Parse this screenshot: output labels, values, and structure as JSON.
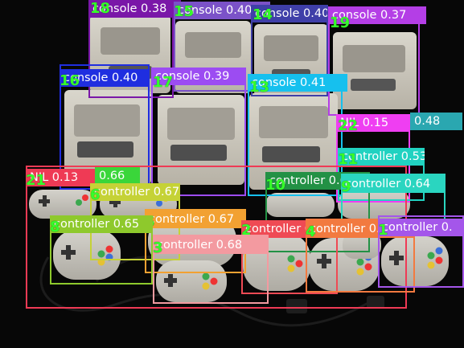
{
  "detections": [
    {
      "id": "18",
      "label": "console 0.38",
      "color": "#7a17a8"
    },
    {
      "id": "15",
      "label": "console 0.40",
      "color": "#7b52c8"
    },
    {
      "id": "14",
      "label": "console 0.40",
      "color": "#3f3fa8"
    },
    {
      "id": "19",
      "label": "console 0.37",
      "color": "#b43ee6"
    },
    {
      "id": "16",
      "label": "console 0.40",
      "color": "#1f2ee0"
    },
    {
      "id": "17",
      "label": "console 0.39",
      "color": "#9c4cf2"
    },
    {
      "id": "13",
      "label": "console 0.41",
      "color": "#16c0ee"
    },
    {
      "id": "22",
      "label": "NIL 0.15",
      "color": "#ef3ef2"
    },
    {
      "id": "20",
      "label": "0.48",
      "color": "#2aa7b0"
    },
    {
      "id": "11",
      "label": "controller 0.53",
      "color": "#21d2c1"
    },
    {
      "id": "21",
      "label": "NIL 0.13",
      "color": "#ef3a55"
    },
    {
      "id": "10",
      "label": "controller 0.62",
      "color": "#239145"
    },
    {
      "id": "9",
      "label": "controller 0.64",
      "color": "#2ad5c0"
    },
    {
      "id": "7",
      "label": "0.66",
      "color": "#3ad63a"
    },
    {
      "id": "6",
      "label": "controller 0.67",
      "color": "#c5d236"
    },
    {
      "id": "5",
      "label": "controller 0.67",
      "color": "#f2a132"
    },
    {
      "id": "8",
      "label": "controller 0.65",
      "color": "#8ec92c"
    },
    {
      "id": "2",
      "label": "controller 0.68",
      "color": "#ef4a54"
    },
    {
      "id": "3",
      "label": "controller 0.68",
      "color": "#f39aa0"
    },
    {
      "id": "4",
      "label": "controller 0.67",
      "color": "#f27a40"
    },
    {
      "id": "1",
      "label": "controller 0.",
      "color": "#a456ea"
    }
  ]
}
